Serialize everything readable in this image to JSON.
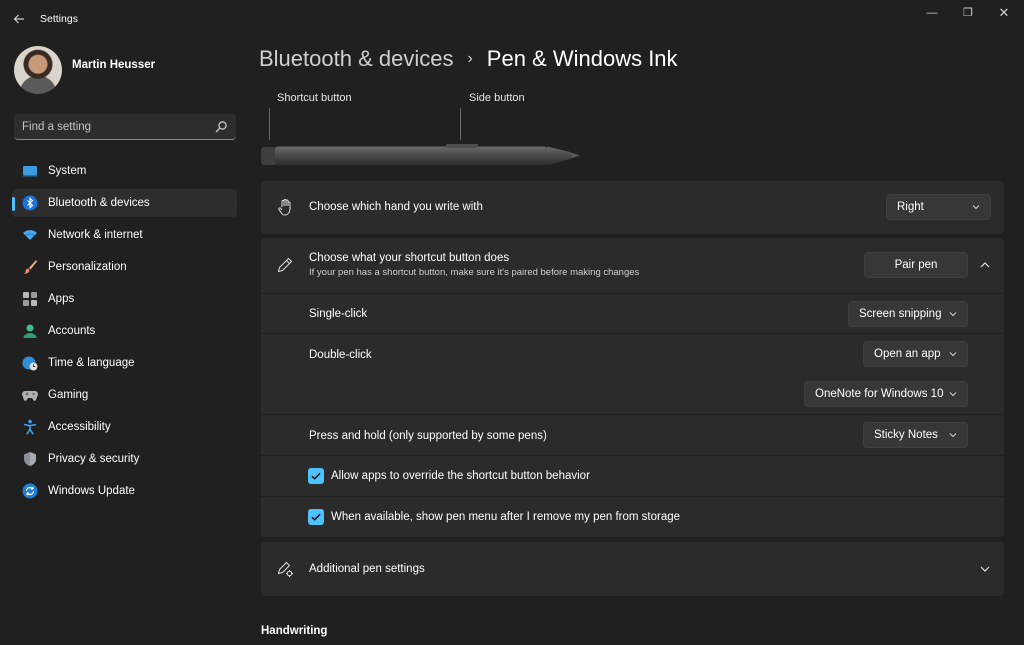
{
  "window": {
    "title": "Settings",
    "minimize_glyph": "—",
    "restore_glyph": "❐",
    "close_glyph": "✕"
  },
  "profile": {
    "name": "Martin Heusser"
  },
  "search": {
    "placeholder": "Find a setting"
  },
  "sidebar": {
    "items": [
      {
        "label": "System",
        "icon": "system-icon",
        "active": false
      },
      {
        "label": "Bluetooth & devices",
        "icon": "bluetooth-icon",
        "active": true
      },
      {
        "label": "Network & internet",
        "icon": "wifi-icon",
        "active": false
      },
      {
        "label": "Personalization",
        "icon": "brush-icon",
        "active": false
      },
      {
        "label": "Apps",
        "icon": "apps-icon",
        "active": false
      },
      {
        "label": "Accounts",
        "icon": "accounts-icon",
        "active": false
      },
      {
        "label": "Time & language",
        "icon": "globe-clock-icon",
        "active": false
      },
      {
        "label": "Gaming",
        "icon": "gamepad-icon",
        "active": false
      },
      {
        "label": "Accessibility",
        "icon": "accessibility-icon",
        "active": false
      },
      {
        "label": "Privacy & security",
        "icon": "shield-icon",
        "active": false
      },
      {
        "label": "Windows Update",
        "icon": "update-icon",
        "active": false
      }
    ]
  },
  "breadcrumb": {
    "parent": "Bluetooth & devices",
    "separator": "›",
    "current": "Pen & Windows Ink"
  },
  "pen_diagram": {
    "shortcut_label": "Shortcut button",
    "side_label": "Side button"
  },
  "hand": {
    "title": "Choose which hand you write with",
    "value": "Right"
  },
  "shortcut": {
    "title": "Choose what your shortcut button does",
    "subtitle": "If your pen has a shortcut button, make sure it's paired before making changes",
    "pair_label": "Pair pen",
    "single_click": {
      "label": "Single-click",
      "value": "Screen snipping"
    },
    "double_click": {
      "label": "Double-click",
      "value": "Open an app",
      "app_value": "OneNote for Windows 10"
    },
    "press_hold": {
      "label": "Press and hold (only supported by some pens)",
      "value": "Sticky Notes"
    },
    "allow_override": {
      "label": "Allow apps to override the shortcut button behavior",
      "checked": true
    },
    "show_menu": {
      "label": "When available, show pen menu after I remove my pen from storage",
      "checked": true
    }
  },
  "additional": {
    "title": "Additional pen settings"
  },
  "handwriting": {
    "heading": "Handwriting"
  },
  "colors": {
    "accent": "#4cc2ff",
    "background": "#202020",
    "card": "#2b2b2b"
  }
}
